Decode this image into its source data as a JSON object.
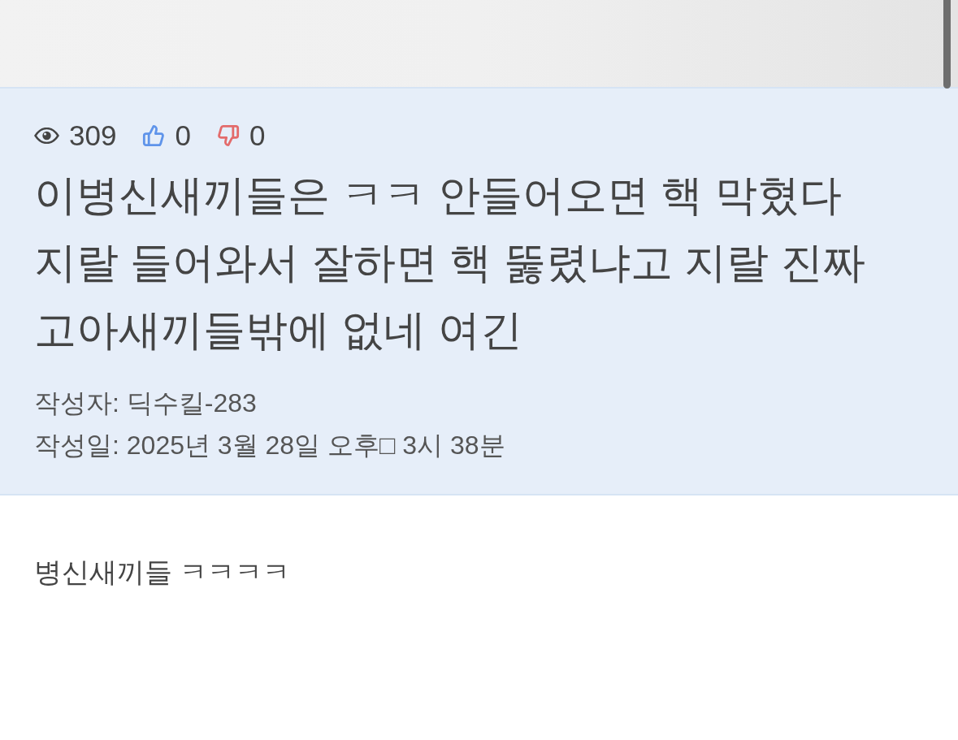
{
  "post": {
    "stats": {
      "views": "309",
      "likes": "0",
      "dislikes": "0"
    },
    "title": "이병신새끼들은 ㅋㅋ 안들어오면 핵 막혔다 지랄 들어와서 잘하면 핵 뚫렸냐고 지랄 진짜 고아새끼들밖에 없네 여긴",
    "author": "작성자: 딕수킬-283",
    "date": "작성일: 2025년 3월 28일 오후□ 3시 38분"
  },
  "body": {
    "text": "병신새끼들 ㅋㅋㅋㅋ"
  }
}
